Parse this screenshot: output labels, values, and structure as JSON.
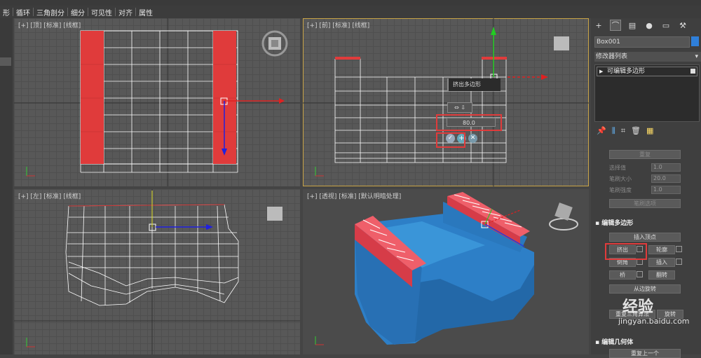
{
  "menubar": {
    "items": [
      "形",
      "循环",
      "三角剖分",
      "细分",
      "可见性",
      "对齐",
      "属性"
    ]
  },
  "viewports": {
    "top": {
      "label": "[+] [顶] [标准] [线框]"
    },
    "front": {
      "label": "[+] [前] [标准] [线框]"
    },
    "left": {
      "label": "[+] [左] [标准] [线框]"
    },
    "perspective": {
      "label": "[+] [透视] [标准] [默认明暗处理]"
    }
  },
  "caddy": {
    "title": "挤出多边形",
    "value": "80.0"
  },
  "cmdpanel": {
    "object_name": "Box001",
    "modifier_list": "修改器列表",
    "stack_item": "可编辑多边形",
    "upper": {
      "repeat_button": "重复",
      "row1_label": "选择值",
      "row1_value": "1.0",
      "row2_label": "笔刷大小",
      "row2_value": "20.0",
      "row3_label": "笔刷强度",
      "row3_value": "1.0",
      "options_button": "笔刷选项"
    },
    "edit_poly": {
      "header": "编辑多边形",
      "insert_vertex": "插入顶点",
      "extrude": "挤出",
      "outline": "轮廓",
      "bevel": "倒角",
      "inset": "插入",
      "bridge": "桥",
      "flip": "翻转",
      "hinge": "从边旋转",
      "retri": "重复三角算法",
      "turn": "旋转"
    },
    "edit_geom": {
      "header": "编辑几何体",
      "repeat_last": "重复上一个"
    }
  },
  "watermark": {
    "text": "经验",
    "url": "jingyan.baidu.com"
  },
  "colors": {
    "accent": "#e03b3b",
    "object": "#2f7fd9",
    "active_border": "#c9a447"
  }
}
